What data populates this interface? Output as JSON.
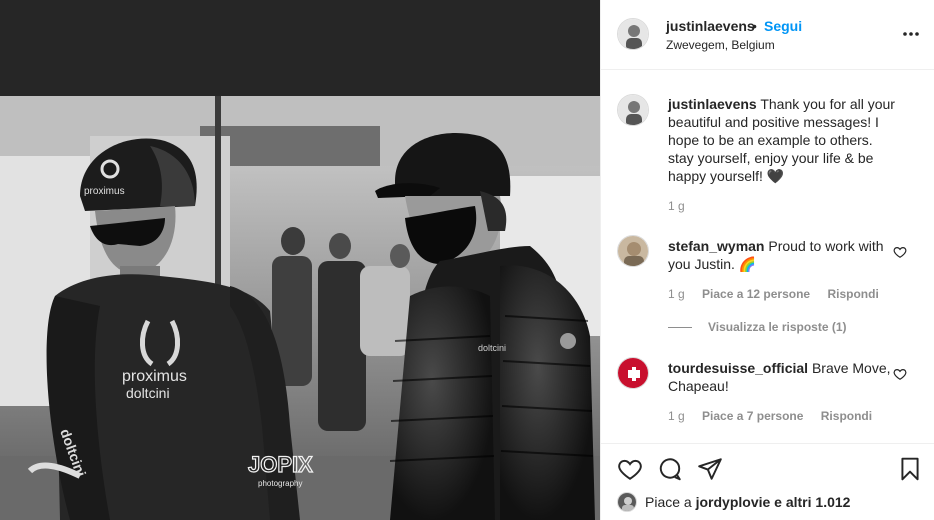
{
  "post": {
    "username": "justinlaevens",
    "separator": "•",
    "follow_label": "Segui",
    "location": "Zwevegem, Belgium",
    "more_icon": "more-horizontal-icon"
  },
  "photo": {
    "watermark_line1": "JOPIX",
    "watermark_line2": "photography",
    "jersey_text1": "proximus",
    "jersey_text2": "doltcini"
  },
  "caption": {
    "username": "justinlaevens",
    "text": "Thank you for all your beautiful and positive messages! I hope to be an example to others. stay yourself, enjoy your life & be happy yourself! 🖤",
    "time": "1 g"
  },
  "comments": [
    {
      "username": "stefan_wyman",
      "text": "Proud to work with you Justin. 🌈",
      "time": "1 g",
      "likes": "Piace a 12 persone",
      "reply": "Rispondi",
      "view_replies": "Visualizza le risposte (1)"
    },
    {
      "username": "tourdesuisse_official",
      "text": "Brave Move, Chapeau!",
      "time": "1 g",
      "likes": "Piace a 7 persone",
      "reply": "Rispondi"
    }
  ],
  "likes_summary": {
    "prefix": "Piace a ",
    "user": "jordyplovie",
    "suffix": " e altri 1.012"
  },
  "colors": {
    "accent": "#0095f6",
    "text": "#262626",
    "muted": "#8e8e8e",
    "border": "#efefef"
  }
}
